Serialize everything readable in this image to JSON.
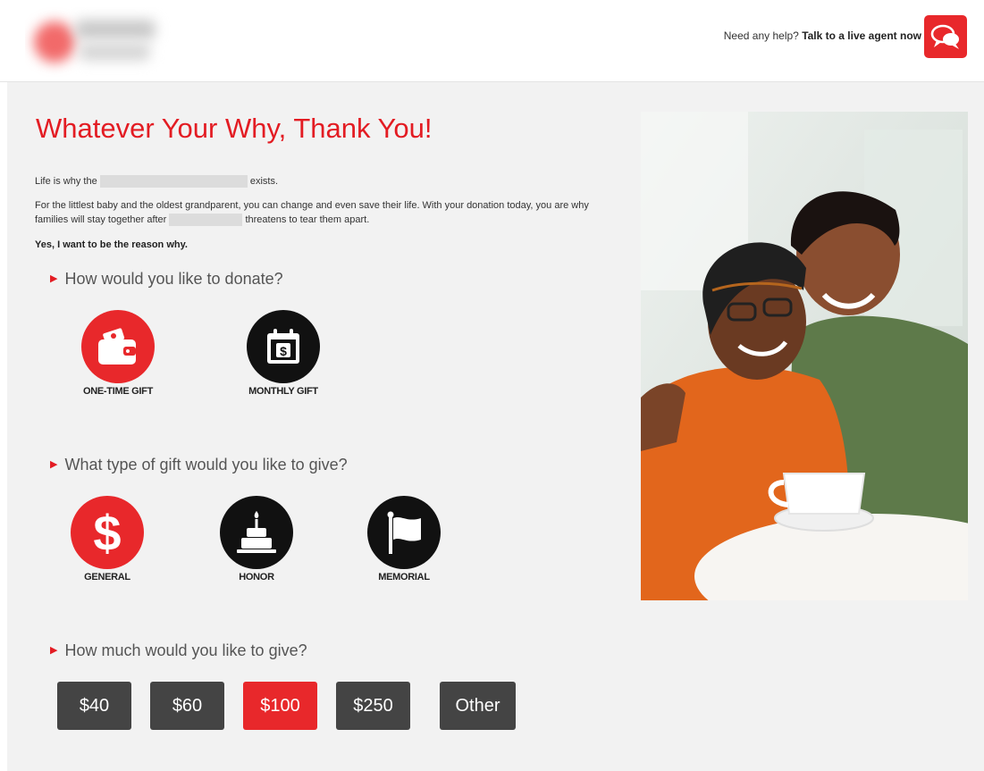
{
  "header": {
    "help_prefix": "Need any help?",
    "help_link": "Talk to a live agent now",
    "chat_icon": "chat-bubbles-icon"
  },
  "main": {
    "title": "Whatever Your Why, Thank You!",
    "intro_start": "Life is why the",
    "intro_end": "exists.",
    "body_start": "For the littlest baby and the oldest grandparent, you can change and even save their life. With your donation today, you are why families will stay together after",
    "body_end": "threatens to tear them apart.",
    "pledge": "Yes, I want to be the reason why."
  },
  "donate": {
    "question": "How would you like to donate?",
    "options": [
      {
        "label": "ONE-TIME GIFT",
        "icon": "wallet-icon",
        "color": "#e8282b"
      },
      {
        "label": "MONTHLY GIFT",
        "icon": "calendar-dollar-icon",
        "color": "#111111"
      }
    ]
  },
  "gift_type": {
    "question": "What type of gift would you like to give?",
    "options": [
      {
        "label": "GENERAL",
        "icon": "dollar-sign-icon",
        "color": "#e8282b"
      },
      {
        "label": "HONOR",
        "icon": "cake-icon",
        "color": "#111111"
      },
      {
        "label": "MEMORIAL",
        "icon": "flag-icon",
        "color": "#111111"
      }
    ]
  },
  "amount": {
    "question": "How much would you like to give?",
    "options": [
      "$40",
      "$60",
      "$100",
      "$250",
      "Other"
    ],
    "selected": "$100"
  },
  "colors": {
    "accent": "#e31c23",
    "button_dark": "#444444",
    "panel_bg": "#f2f2f2"
  }
}
